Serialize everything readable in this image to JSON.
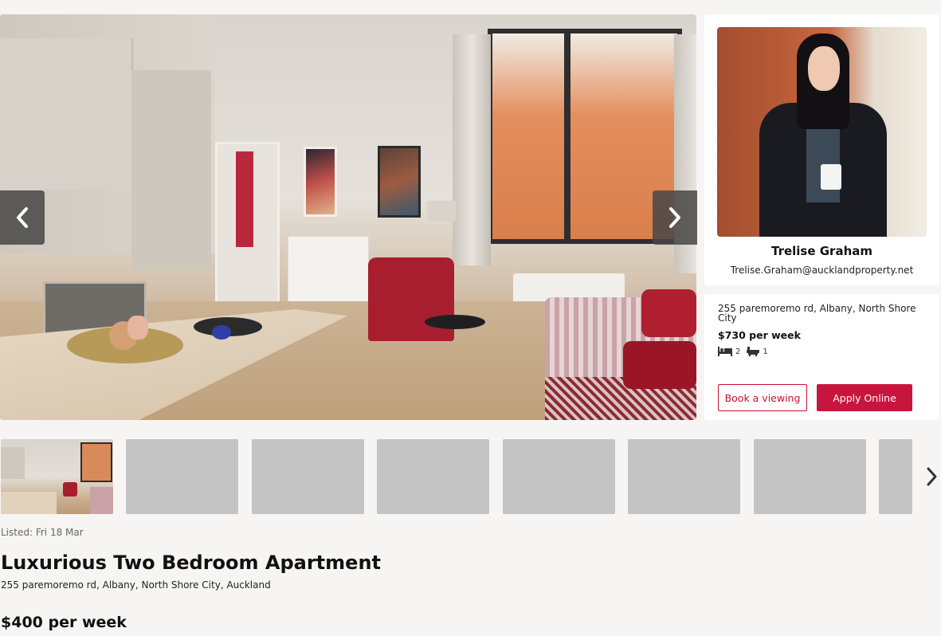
{
  "gallery": {
    "prev_icon": "chevron-left-icon",
    "next_icon": "chevron-right-icon",
    "thumbnail_count": 8,
    "active_thumbnail": 1
  },
  "agent": {
    "name": "Trelise Graham",
    "email": "Trelise.Graham@aucklandproperty.net"
  },
  "listing_card": {
    "address": "255 paremoremo rd, Albany, North Shore City",
    "price": "$730 per week",
    "bedrooms": "2",
    "bathrooms": "1",
    "book_label": "Book a viewing",
    "apply_label": "Apply Online"
  },
  "details": {
    "listed": "Listed: Fri 18 Mar",
    "title": "Luxurious Two Bedroom Apartment",
    "address": "255 paremoremo rd, Albany, North Shore City, Auckland",
    "price": "$400 per week"
  },
  "colors": {
    "accent": "#c8153e",
    "background": "#f6f5f3",
    "placeholder": "#c4c4c4"
  }
}
